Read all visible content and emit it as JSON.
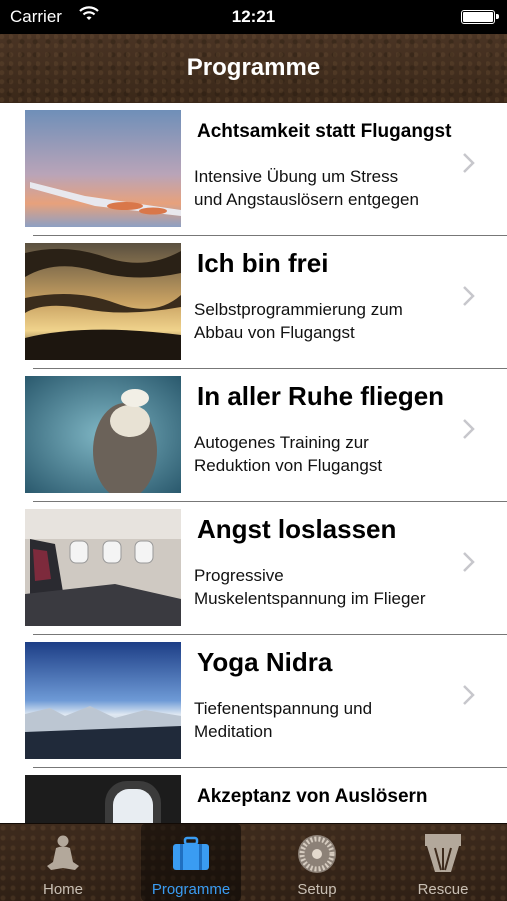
{
  "status_bar": {
    "carrier": "Carrier",
    "time": "12:21"
  },
  "nav": {
    "title": "Programme"
  },
  "programs": [
    {
      "title": "Achtsamkeit statt Flugangst",
      "lines": [
        "Intensive Übung um Stress",
        "und Angstauslösern entgegen"
      ],
      "image": "airplane-wing-sunset"
    },
    {
      "title": "Ich bin frei",
      "lines": [
        "Selbstprogrammierung zum",
        "Abbau von Flugangst"
      ],
      "image": "clouds-sunset"
    },
    {
      "title": "In aller Ruhe fliegen",
      "lines": [
        "Autogenes Training zur",
        "Reduktion von Flugangst"
      ],
      "image": "sea-otter-floating"
    },
    {
      "title": "Angst loslassen",
      "lines": [
        "Progressive",
        "Muskelentspannung im Flieger"
      ],
      "image": "airplane-cabin-seats"
    },
    {
      "title": "Yoga Nidra",
      "lines": [
        "Tiefenentspannung und",
        "Meditation"
      ],
      "image": "aerial-mountains"
    },
    {
      "title": "Akzeptanz von Auslösern",
      "lines": [],
      "image": "airplane-window"
    }
  ],
  "tabbar": {
    "tabs": [
      {
        "label": "Home",
        "icon": "meditating-person-icon",
        "active": false
      },
      {
        "label": "Programme",
        "icon": "suitcase-icon",
        "active": true
      },
      {
        "label": "Setup",
        "icon": "turbine-icon",
        "active": false
      },
      {
        "label": "Rescue",
        "icon": "help-icon",
        "active": false
      }
    ]
  },
  "colors": {
    "accent": "#3a9cf2",
    "nav_brown": "#3f2c1e",
    "tab_label": "#c8bfb4"
  }
}
